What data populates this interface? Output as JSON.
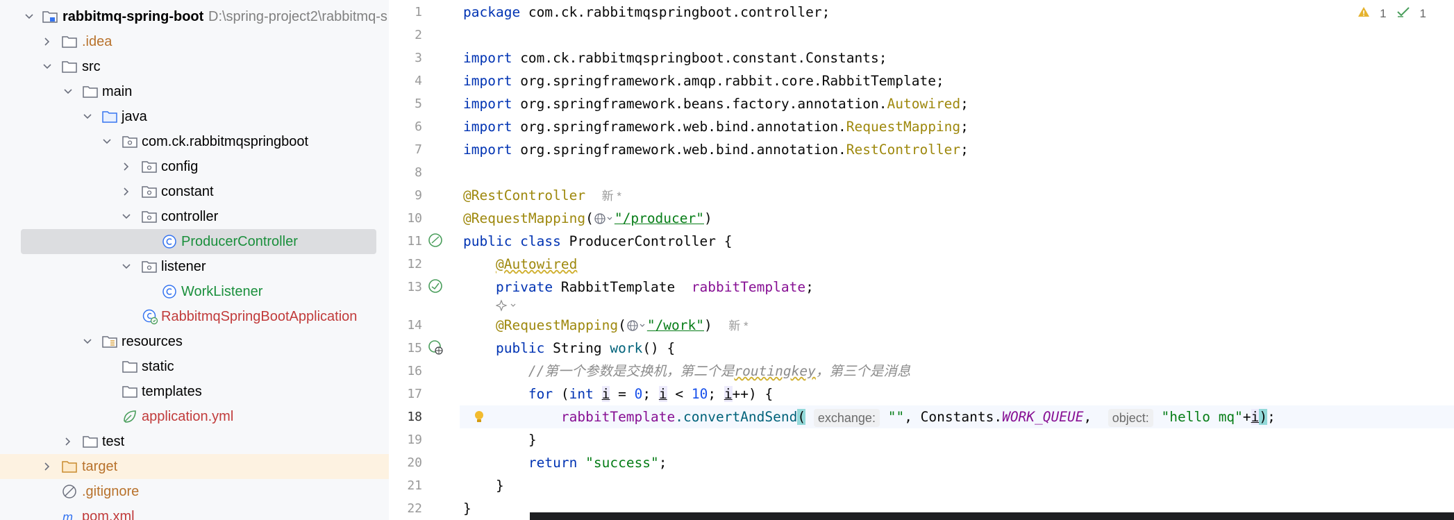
{
  "project": {
    "name": "rabbitmq-spring-boot",
    "path": "D:\\spring-project2\\rabbitmq-s"
  },
  "tree": {
    "idea": ".idea",
    "src": "src",
    "main": "main",
    "java": "java",
    "package": "com.ck.rabbitmqspringboot",
    "config": "config",
    "constant": "constant",
    "controller": "controller",
    "producer_controller": "ProducerController",
    "listener": "listener",
    "work_listener": "WorkListener",
    "app_class": "RabbitmqSpringBootApplication",
    "resources": "resources",
    "static": "static",
    "templates": "templates",
    "application_yml": "application.yml",
    "test": "test",
    "target": "target",
    "gitignore": ".gitignore",
    "pom": "pom.xml"
  },
  "editor": {
    "inspections": {
      "warnings": "1",
      "ok": "1"
    },
    "line_numbers": [
      "1",
      "2",
      "3",
      "4",
      "5",
      "6",
      "7",
      "8",
      "9",
      "10",
      "11",
      "12",
      "13",
      "14",
      "15",
      "16",
      "17",
      "18",
      "19",
      "20",
      "21",
      "22"
    ],
    "new_marker": "新 *",
    "code": {
      "l1_kw": "package",
      "l1_rest": " com.ck.rabbitmqspringboot.controller;",
      "l3_kw": "import",
      "l3_rest": " com.ck.rabbitmqspringboot.constant.Constants;",
      "l4_kw": "import",
      "l4_rest": " org.springframework.amqp.rabbit.core.RabbitTemplate;",
      "l5_kw": "import",
      "l5_rest": " org.springframework.beans.factory.annotation.",
      "l5_ann": "Autowired",
      "l6_kw": "import",
      "l6_rest": " org.springframework.web.bind.annotation.",
      "l6_ann": "RequestMapping",
      "l7_kw": "import",
      "l7_rest": " org.springframework.web.bind.annotation.",
      "l7_ann": "RestController",
      "l9_ann": "@RestController",
      "l10_ann": "@RequestMapping",
      "l10_str": "\"/producer\"",
      "l11_kw": "public class",
      "l11_rest": " ProducerController {",
      "l12_ann": "@Autowired",
      "l13_kw": "private",
      "l13_type": " RabbitTemplate  ",
      "l13_field": "rabbitTemplate",
      "l14_ann": "@RequestMapping",
      "l14_str": "\"/work\"",
      "l15_kw": "public",
      "l15_type": " String ",
      "l15_method": "work",
      "l16_comment_a": "//第一个参数是交换机，第二个是",
      "l16_comment_b": "routingkey",
      "l16_comment_c": "，第三个是消息",
      "l17_kw": "for",
      "l17_int": "int",
      "l17_zero": "0",
      "l17_ten": "10",
      "l18_field": "rabbitTemplate",
      "l18_method": ".convertAndSend",
      "l18_hint1": "exchange:",
      "l18_str1": "\"\"",
      "l18_const": "WORK_QUEUE",
      "l18_hint2": "object:",
      "l18_str2": "\"hello mq\"",
      "l20_kw": "return",
      "l20_str": "\"success\""
    }
  },
  "colors": {
    "keyword": "#0033b3",
    "annotation": "#9e880d",
    "string": "#067d17",
    "field": "#871094",
    "number": "#1750eb",
    "comment": "#8c8c8c"
  }
}
